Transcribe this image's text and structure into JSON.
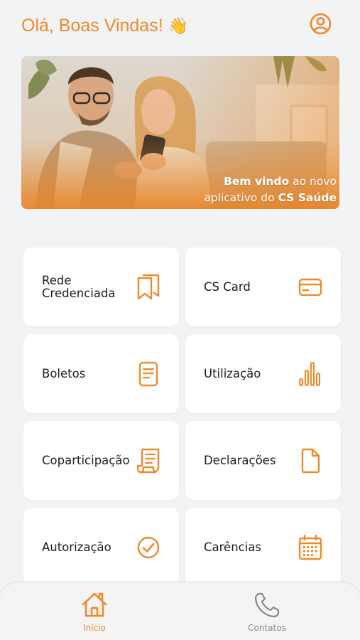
{
  "header": {
    "greeting": "Olá, Boas Vindas!",
    "wave_emoji": "👋",
    "profile_icon": "user-circle-icon"
  },
  "banner": {
    "line1_bold": "Bem vindo",
    "line1_rest": " ao novo",
    "line2_rest": "aplicativo do ",
    "line2_bold": "CS Saúde"
  },
  "cards": [
    {
      "label": "Rede Credenciada",
      "icon": "bookmarks-icon"
    },
    {
      "label": "CS Card",
      "icon": "credit-card-icon"
    },
    {
      "label": "Boletos",
      "icon": "document-icon"
    },
    {
      "label": "Utilização",
      "icon": "bar-chart-icon"
    },
    {
      "label": "Coparticipação",
      "icon": "scroll-icon"
    },
    {
      "label": "Declarações",
      "icon": "file-icon"
    },
    {
      "label": "Autorização",
      "icon": "check-circle-icon"
    },
    {
      "label": "Carências",
      "icon": "calendar-icon"
    }
  ],
  "tabbar": {
    "home_label": "Início",
    "contacts_label": "Contatos"
  },
  "colors": {
    "accent": "#ee8a2c",
    "inactive": "#8a8a8e",
    "background": "#f2f3f5"
  }
}
